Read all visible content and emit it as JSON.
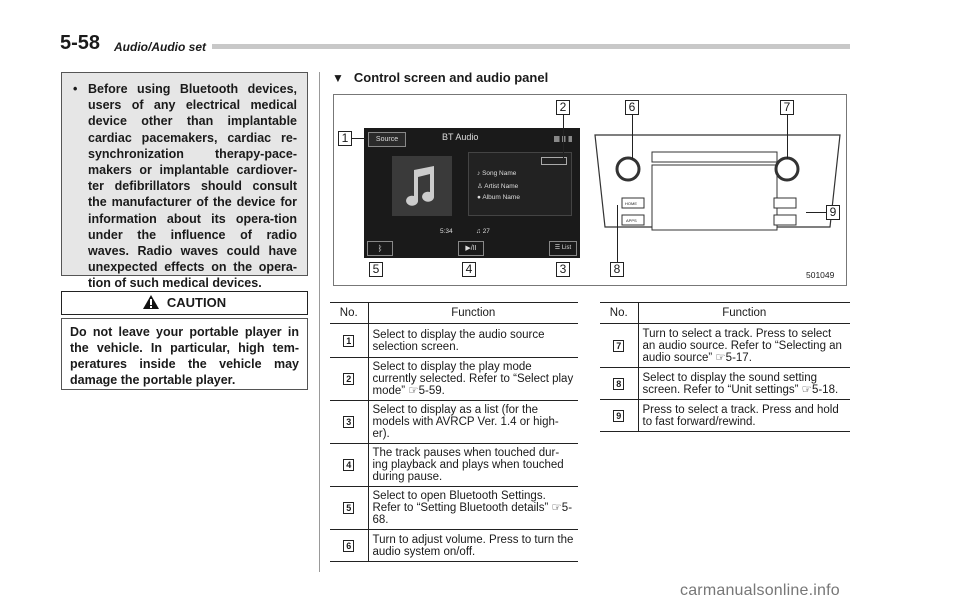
{
  "header": {
    "page_number": "5-58",
    "section": "Audio/Audio set"
  },
  "warning": {
    "bullet": "•",
    "text": "Before using Bluetooth devices, users of any electrical medical device other than implantable cardiac pacemakers, cardiac re-synchronization therapy-pace-makers or implantable cardiover-ter defibrillators should consult the manufacturer of the device for information about its opera-tion under the influence of radio waves. Radio waves could have unexpected effects on the opera-tion of such medical devices."
  },
  "caution": {
    "title": "CAUTION",
    "text": "Do not leave your portable player in the vehicle. In particular, high tem-peratures inside the vehicle may damage the portable player."
  },
  "subsection": {
    "marker": "▼",
    "title": "Control screen and audio panel"
  },
  "figure": {
    "id": "501049",
    "screen": {
      "source_button": "Source",
      "title": "BT Audio",
      "song": "Song Name",
      "artist": "Artist Name",
      "album": "Album Name",
      "time": "5:34",
      "track": "27",
      "play_pause": "▶/II",
      "list_button": "List"
    },
    "panel": {
      "home": "HOME",
      "apps": "APPS",
      "volume": "VOLUME"
    },
    "callouts": [
      "1",
      "2",
      "3",
      "4",
      "5",
      "6",
      "7",
      "8",
      "9"
    ]
  },
  "tables": {
    "header_no": "No.",
    "header_function": "Function",
    "left": [
      {
        "no": "1",
        "function": "Select to display the audio source selection screen."
      },
      {
        "no": "2",
        "function": "Select to display the play mode currently selected. Refer to “Select play mode” ☞5-59."
      },
      {
        "no": "3",
        "function": "Select to display as a list (for the models with AVRCP Ver. 1.4 or high-er)."
      },
      {
        "no": "4",
        "function": "The track pauses when touched dur-ing playback and plays when touched during pause."
      },
      {
        "no": "5",
        "function": "Select to open Bluetooth Settings. Refer to “Setting Bluetooth details” ☞5-68."
      },
      {
        "no": "6",
        "function": "Turn to adjust volume. Press to turn the audio system on/off."
      }
    ],
    "right": [
      {
        "no": "7",
        "function": "Turn to select a track. Press to select an audio source. Refer to “Selecting an audio source” ☞5-17."
      },
      {
        "no": "8",
        "function": "Select to display the sound setting screen. Refer to “Unit settings” ☞5-18."
      },
      {
        "no": "9",
        "function": "Press to select a track. Press and hold to fast forward/rewind."
      }
    ]
  },
  "watermark": "carmanualsonline.info"
}
